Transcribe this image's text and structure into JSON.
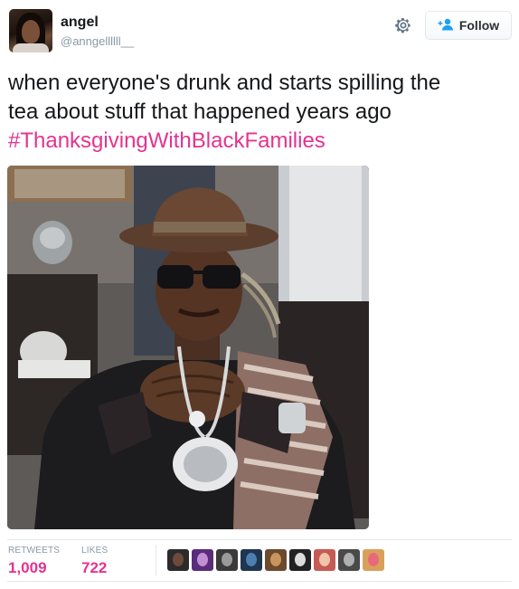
{
  "user": {
    "display_name": "angel",
    "handle": "@anngellllll__"
  },
  "header": {
    "settings_icon": "gear-icon",
    "follow_label": "Follow",
    "follow_icon": "add-user-icon"
  },
  "tweet": {
    "text_lines": [
      "when everyone's drunk and starts spilling the",
      "tea about stuff that happened years ago"
    ],
    "hashtag": "#ThanksgivingWithBlackFamilies"
  },
  "stats": {
    "retweets_label": "RETWEETS",
    "retweets_value": "1,009",
    "likes_label": "LIKES",
    "likes_value": "722"
  },
  "likers_count": 9,
  "colors": {
    "hashtag": "#e4338f",
    "stat_value": "#e4338f",
    "follow_icon": "#1da1f2",
    "meta_text": "#8899a6",
    "divider": "#e1e8ed"
  }
}
